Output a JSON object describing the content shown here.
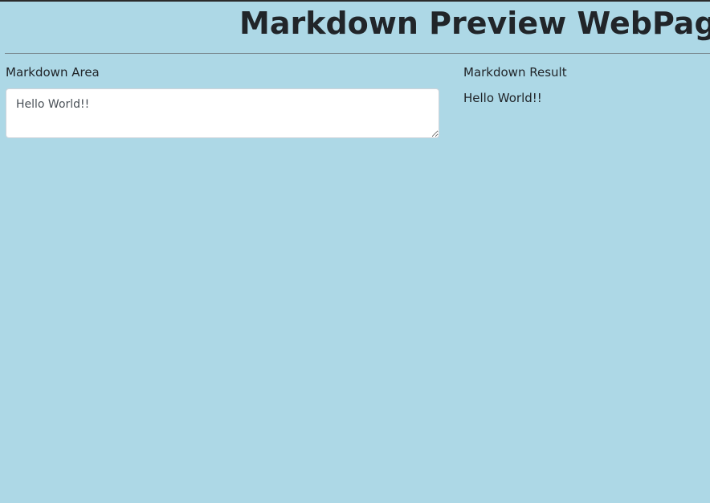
{
  "header": {
    "title": "Markdown Preview WebPage"
  },
  "editor": {
    "label": "Markdown Area",
    "value": "Hello World!!"
  },
  "preview": {
    "label": "Markdown Result",
    "rendered_text": "Hello World!!"
  },
  "colors": {
    "background": "#add8e6",
    "text": "#212529",
    "textarea_background": "#ffffff"
  }
}
